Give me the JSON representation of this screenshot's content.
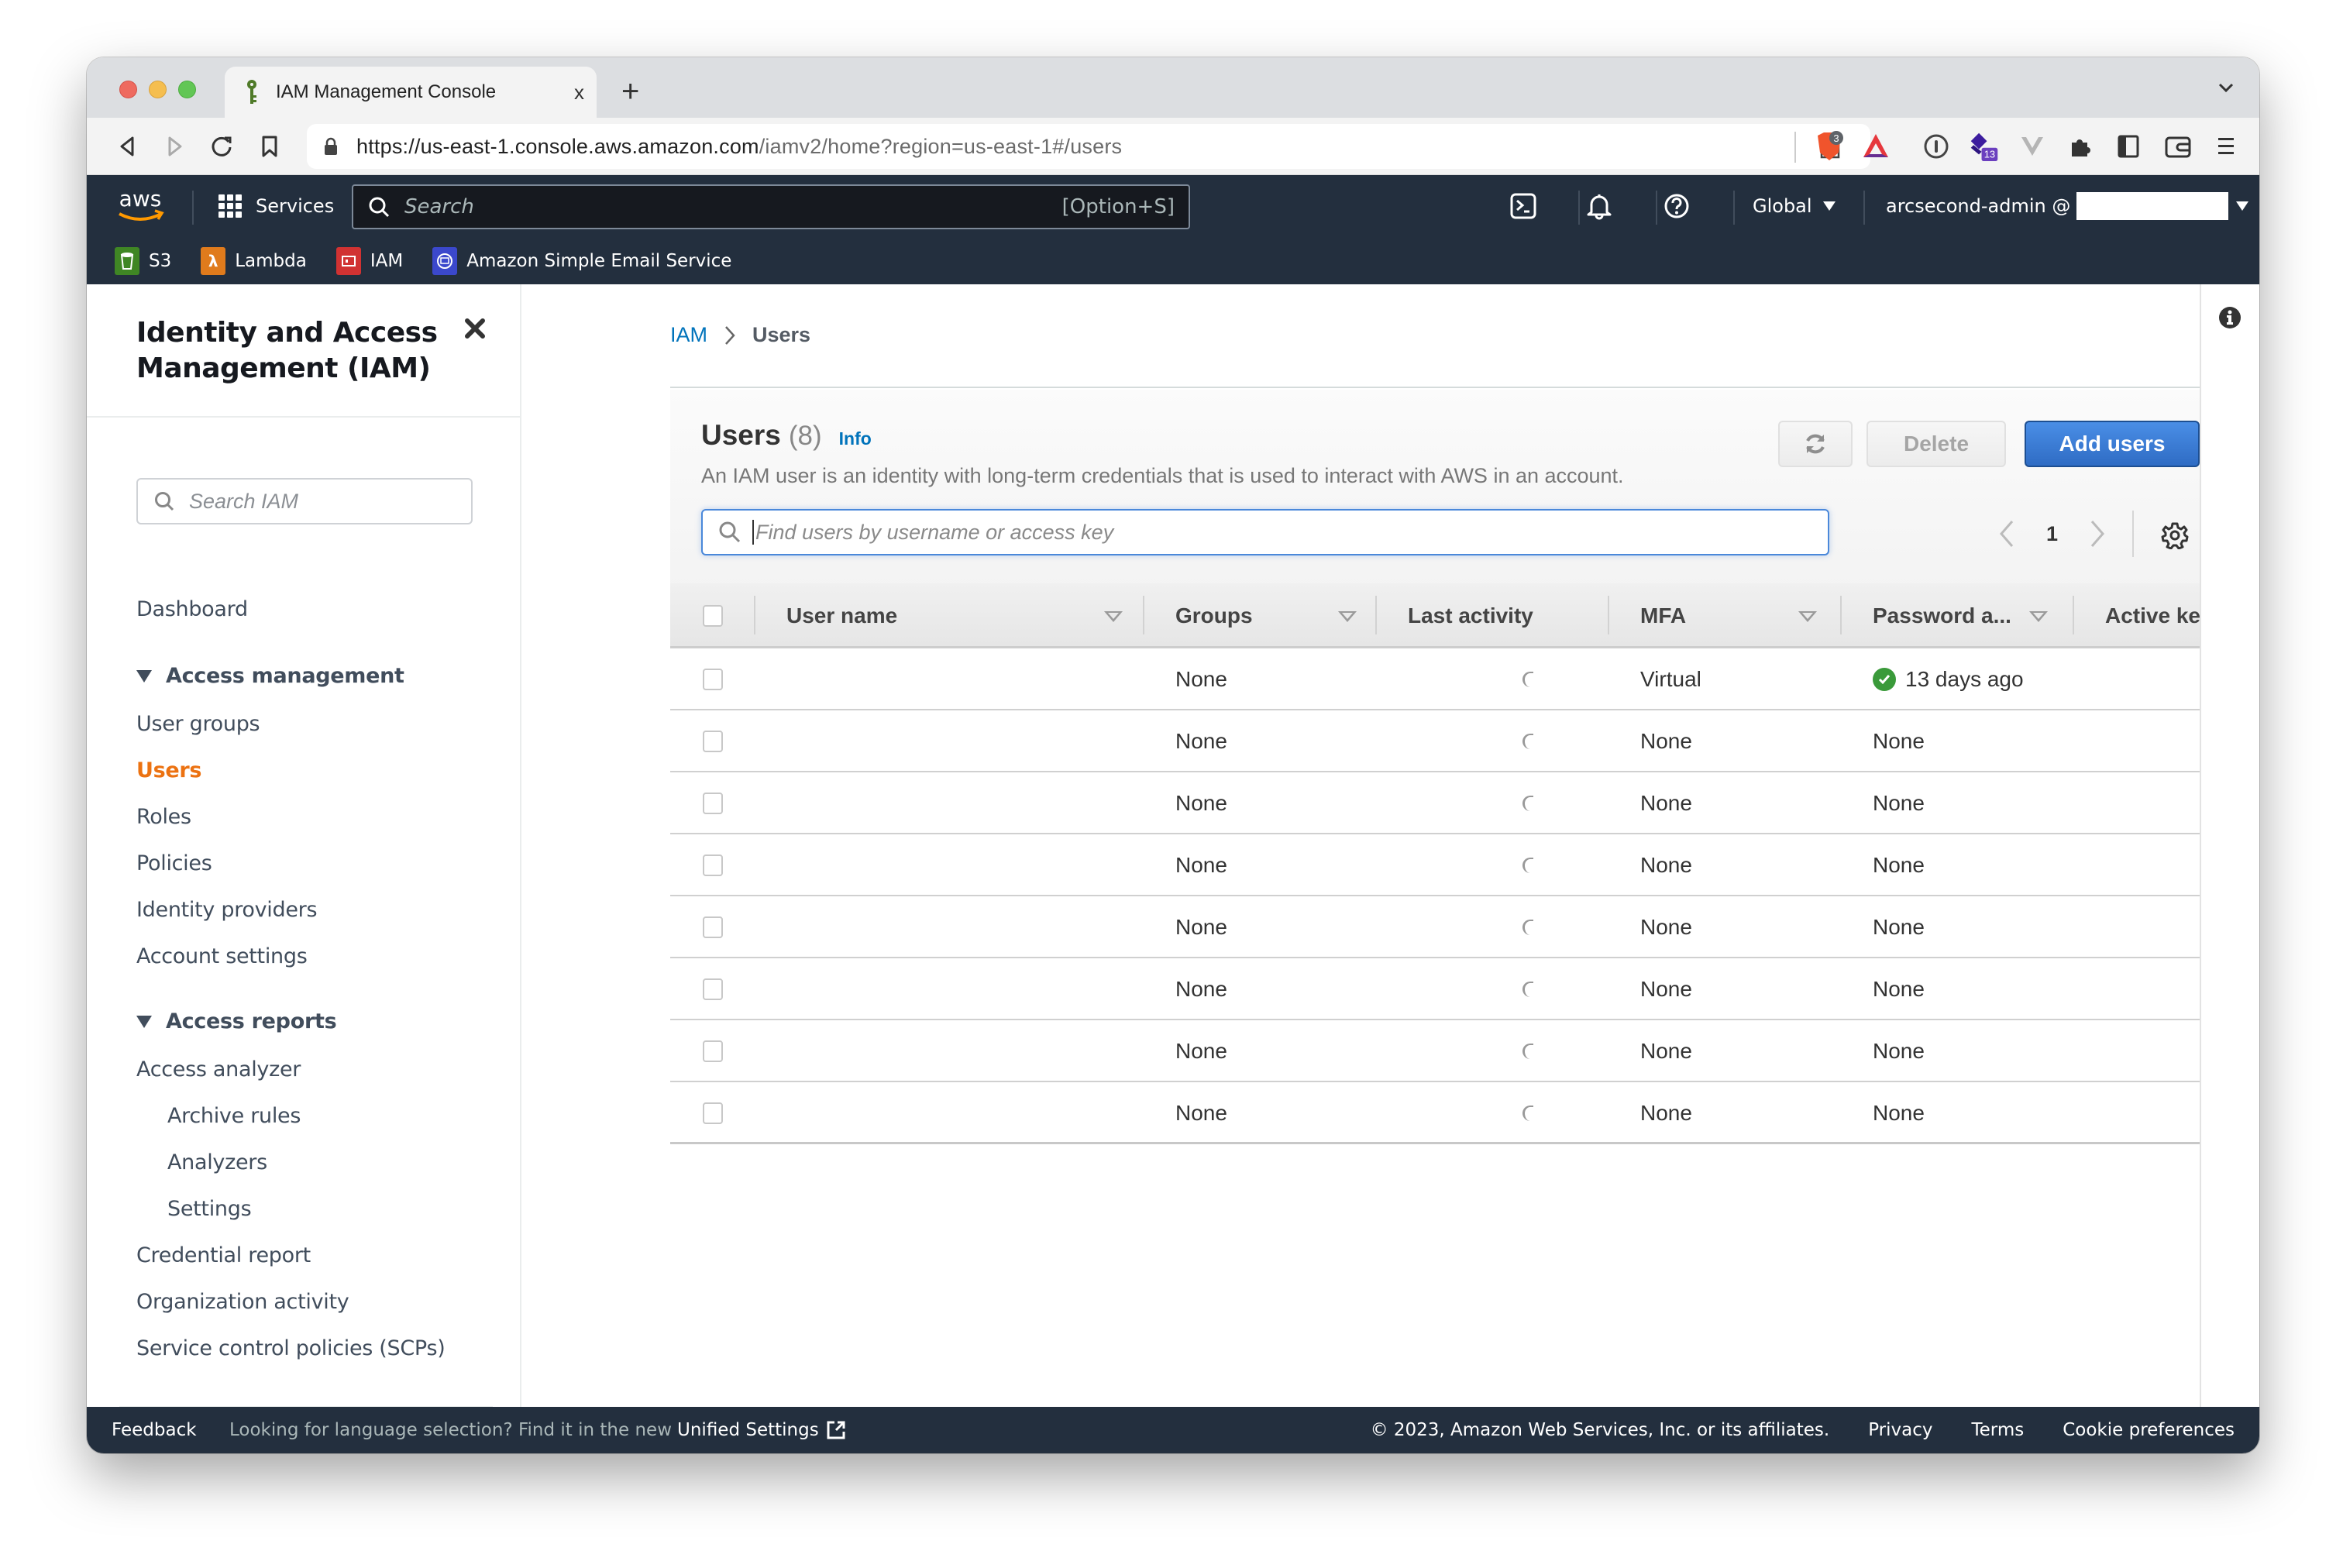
{
  "browser": {
    "tab_title": "IAM Management Console",
    "tab_close": "x",
    "new_tab": "+",
    "url_host": "https://us-east-1.console.aws.amazon.com",
    "url_path": "/iamv2/home?region=us-east-1#/users",
    "extensions": {
      "brave_badge": "3",
      "stack_badge": "13"
    }
  },
  "aws_header": {
    "services_label": "Services",
    "search_placeholder": "Search",
    "search_shortcut": "[Option+S]",
    "region_label": "Global",
    "account_label": "arcsecond-admin @",
    "favorites": [
      {
        "label": "S3",
        "color": "#3f8624"
      },
      {
        "label": "Lambda",
        "color": "#e07b1c"
      },
      {
        "label": "IAM",
        "color": "#d13232"
      },
      {
        "label": "Amazon Simple Email Service",
        "color": "#3b48cc"
      }
    ]
  },
  "sidebar": {
    "title_line1": "Identity and Access",
    "title_line2": "Management (IAM)",
    "search_placeholder": "Search IAM",
    "dashboard": "Dashboard",
    "sections": [
      {
        "label": "Access management",
        "items": [
          "User groups",
          "Users",
          "Roles",
          "Policies",
          "Identity providers",
          "Account settings"
        ]
      },
      {
        "label": "Access reports",
        "items": [
          "Access analyzer",
          "Archive rules",
          "Analyzers",
          "Settings",
          "Credential report",
          "Organization activity",
          "Service control policies (SCPs)"
        ]
      }
    ],
    "active_item": "Users",
    "active_color": "#ec7211"
  },
  "breadcrumb": {
    "root": "IAM",
    "current": "Users"
  },
  "users_panel": {
    "title": "Users",
    "count": "(8)",
    "info_label": "Info",
    "description": "An IAM user is an identity with long-term credentials that is used to interact with AWS in an account.",
    "delete_label": "Delete",
    "add_label": "Add users",
    "filter_placeholder": "Find users by username or access key",
    "page": "1",
    "columns": [
      "User name",
      "Groups",
      "Last activity",
      "MFA",
      "Password a...",
      "Active key a"
    ],
    "rows": [
      {
        "user": "",
        "groups": "None",
        "last_activity": "",
        "mfa": "Virtual",
        "password_age": "13 days ago",
        "password_ok": true
      },
      {
        "user": "",
        "groups": "None",
        "last_activity": "",
        "mfa": "None",
        "password_age": "None",
        "password_ok": false
      },
      {
        "user": "",
        "groups": "None",
        "last_activity": "",
        "mfa": "None",
        "password_age": "None",
        "password_ok": false
      },
      {
        "user": "",
        "groups": "None",
        "last_activity": "",
        "mfa": "None",
        "password_age": "None",
        "password_ok": false
      },
      {
        "user": "",
        "groups": "None",
        "last_activity": "",
        "mfa": "None",
        "password_age": "None",
        "password_ok": false
      },
      {
        "user": "",
        "groups": "None",
        "last_activity": "",
        "mfa": "None",
        "password_age": "None",
        "password_ok": false
      },
      {
        "user": "",
        "groups": "None",
        "last_activity": "",
        "mfa": "None",
        "password_age": "None",
        "password_ok": false
      },
      {
        "user": "",
        "groups": "None",
        "last_activity": "",
        "mfa": "None",
        "password_age": "None",
        "password_ok": false
      }
    ],
    "accent_color": "#2f6cc4"
  },
  "footer": {
    "feedback": "Feedback",
    "language_msg": "Looking for language selection? Find it in the new",
    "unified_settings": "Unified Settings",
    "copyright": "© 2023, Amazon Web Services, Inc. or its affiliates.",
    "privacy": "Privacy",
    "terms": "Terms",
    "cookies": "Cookie preferences"
  }
}
